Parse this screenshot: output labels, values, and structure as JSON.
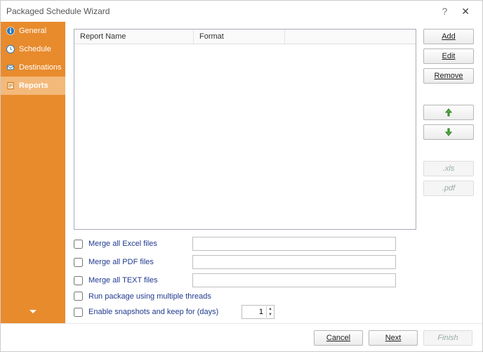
{
  "window": {
    "title": "Packaged Schedule Wizard"
  },
  "sidebar": {
    "items": [
      {
        "label": "General"
      },
      {
        "label": "Schedule"
      },
      {
        "label": "Destinations"
      },
      {
        "label": "Reports"
      }
    ]
  },
  "table": {
    "columns": {
      "c1": "Report Name",
      "c2": "Format",
      "c3": ""
    }
  },
  "buttons": {
    "add": "Add",
    "edit": "Edit",
    "remove": "Remove",
    "xls": ".xls",
    "pdf": ".pdf"
  },
  "options": {
    "merge_excel": {
      "label": "Merge all Excel files",
      "value": ""
    },
    "merge_pdf": {
      "label": "Merge all PDF files",
      "value": ""
    },
    "merge_text": {
      "label": "Merge all TEXT files",
      "value": ""
    },
    "multithread": {
      "label": "Run package using multiple threads"
    },
    "snapshots": {
      "label": "Enable snapshots and keep for (days)",
      "value": "1"
    }
  },
  "footer": {
    "cancel": "Cancel",
    "next": "Next",
    "finish": "Finish"
  }
}
